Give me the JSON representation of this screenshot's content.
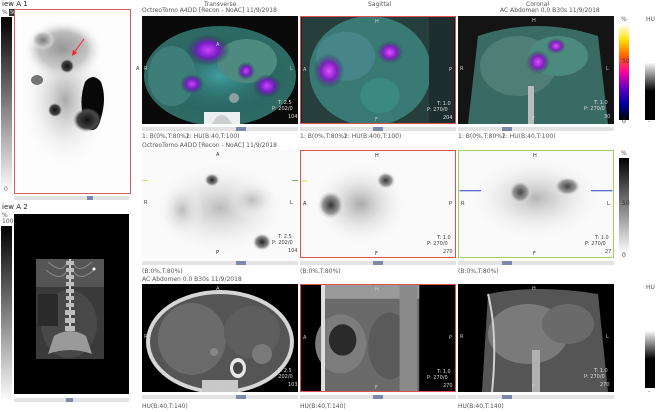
{
  "left_panel": {
    "view1": {
      "title": "iew A 1",
      "scale_top": "%",
      "scale_top2": "50",
      "scale_mid": "27",
      "scale_bottom": "0"
    },
    "view2": {
      "title": "iew A 2",
      "scale_top": "%",
      "scale_top2": "100"
    }
  },
  "row1": {
    "headers": {
      "transverse": "Transverse",
      "sagittal": "Sagittal",
      "coronal": "Coronal"
    },
    "info": "OctreoTomo A4DD [Recon - NoAC] 11/9/2018",
    "info_right": "AC Abdomen 0.0 B30s 11/9/2018",
    "fusion_labels": [
      "1: B(0%,T:80%)",
      "2: HU(B:40,T:100)",
      "1: B(0%,T:80%)",
      "2: HU(B:400,T:100)",
      "1: B(0%,T:80%)",
      "2: HU(B:40,T:100)"
    ],
    "panels": [
      {
        "t": "T: 2.5",
        "p": "P: 202/0",
        "slice": "104"
      },
      {
        "t": "T: 1.0",
        "p": "P: 270/0",
        "slice": "204"
      },
      {
        "t": "T: 1.0",
        "p": "P: 270/0",
        "slice": "30"
      }
    ],
    "colorbar": {
      "top": "%",
      "mid": "50",
      "bottom": "0",
      "right_top": "HU",
      "right_bottom": "-"
    }
  },
  "row2": {
    "info": "OctreoTomo A4DD [Recon - NoAC] 11/9/2018",
    "footers": [
      "(B:0%,T:80%)",
      "(B:0%,T:80%)",
      "(B:0%,T:80%)"
    ],
    "panels": [
      {
        "t": "T: 2.5",
        "p": "P: 202/0",
        "slice": "104"
      },
      {
        "t": "T: 1.0",
        "p": "P: 270/0",
        "slice": "270"
      },
      {
        "t": "T: 1.0",
        "p": "P: 270/0",
        "slice": "27"
      }
    ],
    "colorbar": {
      "top": "%",
      "mid": "50",
      "bottom": "0"
    }
  },
  "row3": {
    "info": "AC Abdomen 0.0 B30s 11/9/2018",
    "footers": [
      "HU(B:40,T:140)",
      "HU(B:40,T:140)",
      "HU(B:40,T:140)"
    ],
    "panels": [
      {
        "t": "T: 2.5",
        "p": "P: 202/0",
        "slice": "103"
      },
      {
        "t": "T: 1.0",
        "p": "P: 270/0",
        "slice": "270"
      },
      {
        "t": "T: 1.0",
        "p": "P: 270/0",
        "slice": "270"
      }
    ],
    "colorbar": {
      "top": "HU",
      "bottom": "-"
    }
  },
  "orient": {
    "A": "A",
    "P": "P",
    "R": "R",
    "L": "L",
    "S": "S",
    "F": "F",
    "H": "H"
  },
  "colors": {
    "pet_red": "#ff2020",
    "border_red": "#e05050",
    "border_green": "#60c060",
    "accent_blue": "#7a8aa8"
  }
}
